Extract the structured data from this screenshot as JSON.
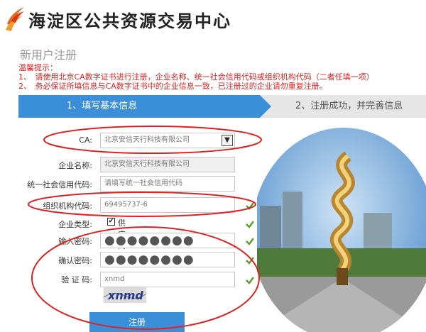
{
  "header": {
    "site_title": "海淀区公共资源交易中心"
  },
  "page": {
    "title": "新用户注册",
    "tips": [
      "温馨提示：",
      "1、　请使用北京CA数字证书进行注册，企业名称、统一社会信用代码或组织机构代码（二者任填一项）",
      "2、　务必保证所填信息与CA数字证书中的企业信息一致，已注册过的企业请勿重复注册。"
    ]
  },
  "steps": {
    "step1": "1、填写基本信息",
    "step2": "2、注册成功，并完善信息"
  },
  "form": {
    "ca_label": "CA:",
    "ca_value": "北京安信天行科技有限公司",
    "company_label": "企业名称:",
    "company_value": "北京安信天行科技有限公司",
    "credit_label": "统一社会信用代码:",
    "credit_placeholder": "请填写统一社会信用代码",
    "org_label": "组织机构代码:",
    "org_value": "69495737-6",
    "type_label": "企业类型:",
    "type_option": "供应商",
    "password_label": "输入密码:",
    "password_value": "●●●●●●●●",
    "confirm_label": "确认密码:",
    "confirm_value": "●●●●●●●●",
    "captcha_label": "验 证 码:",
    "captcha_value": "xnmd",
    "captcha_image_text": "xnmd",
    "submit_label": "注册"
  },
  "colors": {
    "accent": "#3b8ed8",
    "tips": "#e02020",
    "check": "#5aa02c",
    "annotation": "#e02020"
  },
  "icons": [
    "logo-icon",
    "chevron-down-icon",
    "check-icon"
  ]
}
